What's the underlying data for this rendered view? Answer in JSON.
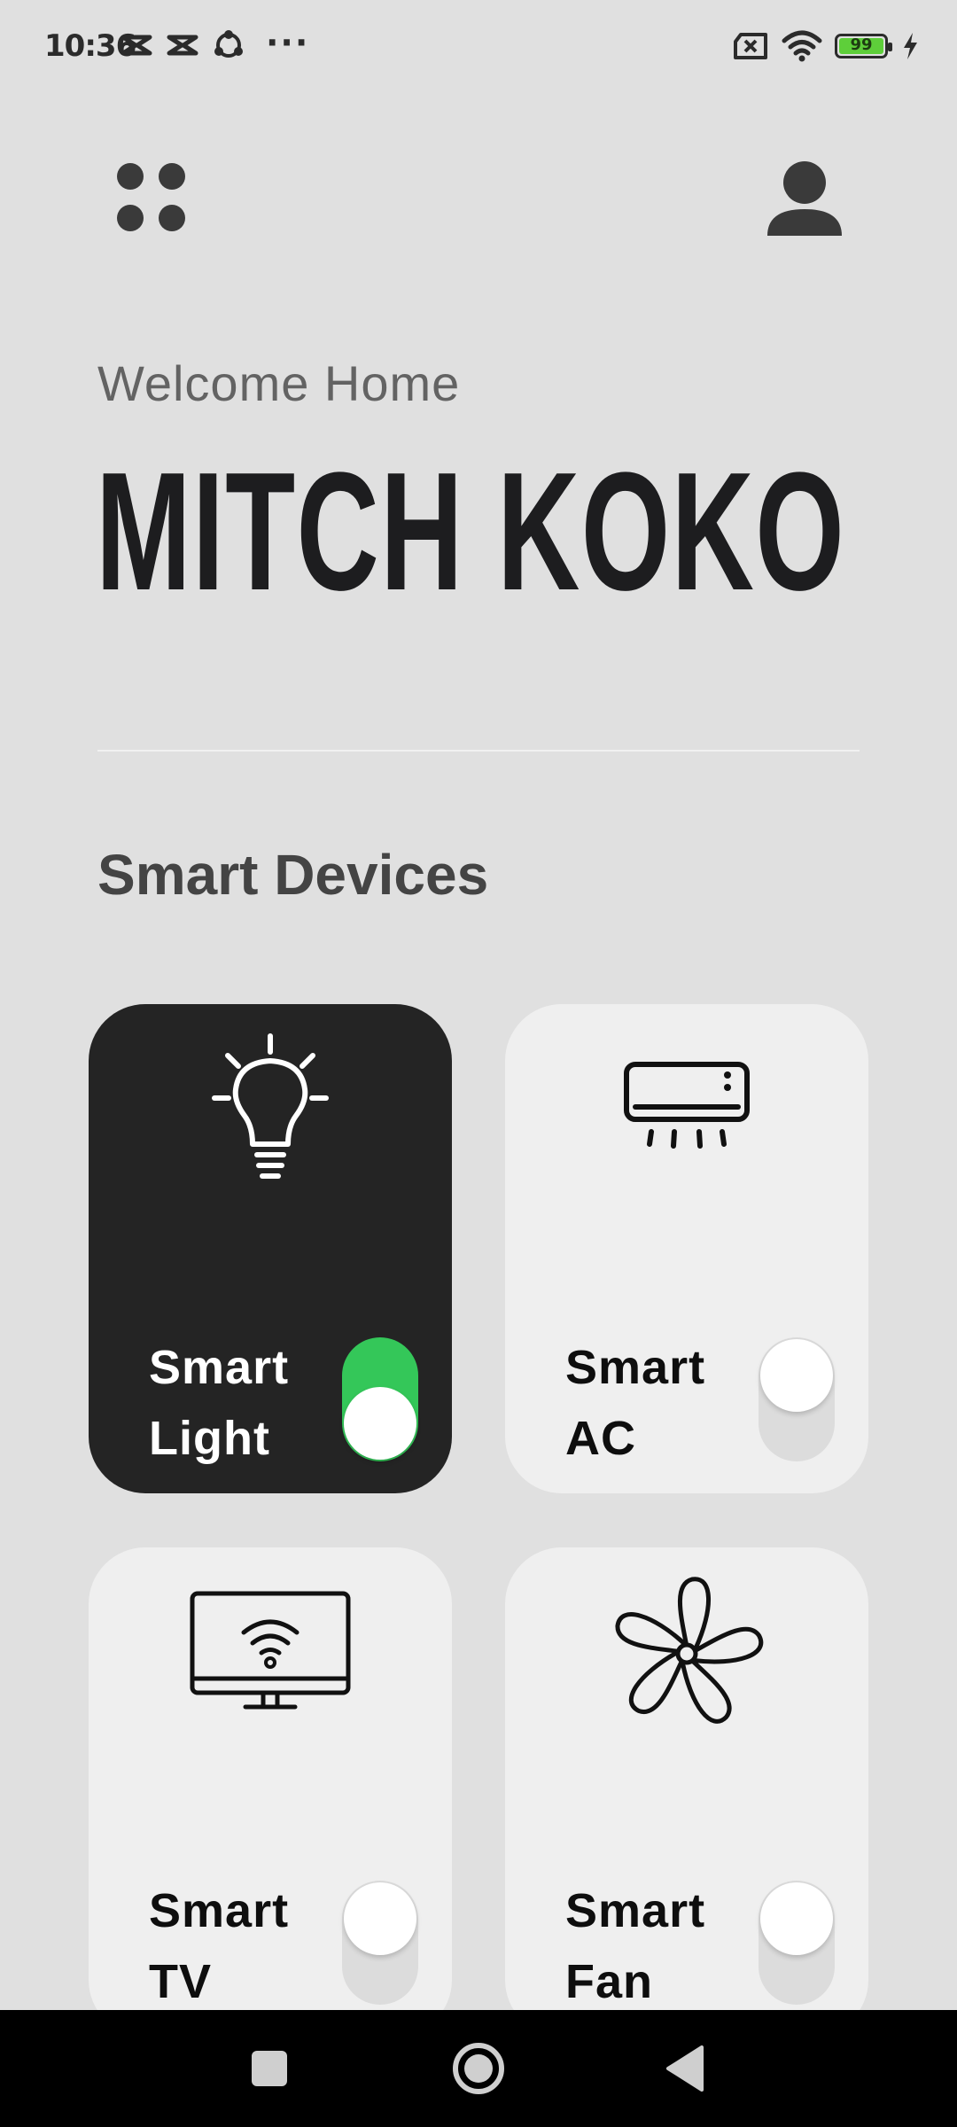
{
  "status_bar": {
    "time": "10:36",
    "overflow": "···",
    "battery_level": "99",
    "icons": [
      "capcut-icon",
      "capcut-icon",
      "sync-icon",
      "no-sim-icon",
      "wifi-icon",
      "battery-icon",
      "charging-icon"
    ]
  },
  "header": {
    "menu_icon": "grid-dots-icon",
    "profile_icon": "person-icon"
  },
  "greeting": {
    "welcome": "Welcome Home",
    "name": "MITCH KOKO"
  },
  "section": {
    "title": "Smart Devices"
  },
  "devices": [
    {
      "line1": "Smart",
      "line2": "Light",
      "icon": "lightbulb-icon",
      "on": true
    },
    {
      "line1": "Smart",
      "line2": "AC",
      "icon": "air-conditioner-icon",
      "on": false
    },
    {
      "line1": "Smart",
      "line2": "TV",
      "icon": "smart-tv-icon",
      "on": false
    },
    {
      "line1": "Smart",
      "line2": "Fan",
      "icon": "fan-icon",
      "on": false
    }
  ],
  "colors": {
    "background": "#e0e0e0",
    "card": "#efefef",
    "card_active": "#242424",
    "toggle_on": "#34c759",
    "toggle_off": "#dcdcdc"
  },
  "nav": {
    "items": [
      "recents-square-icon",
      "home-circle-icon",
      "back-triangle-icon"
    ]
  }
}
